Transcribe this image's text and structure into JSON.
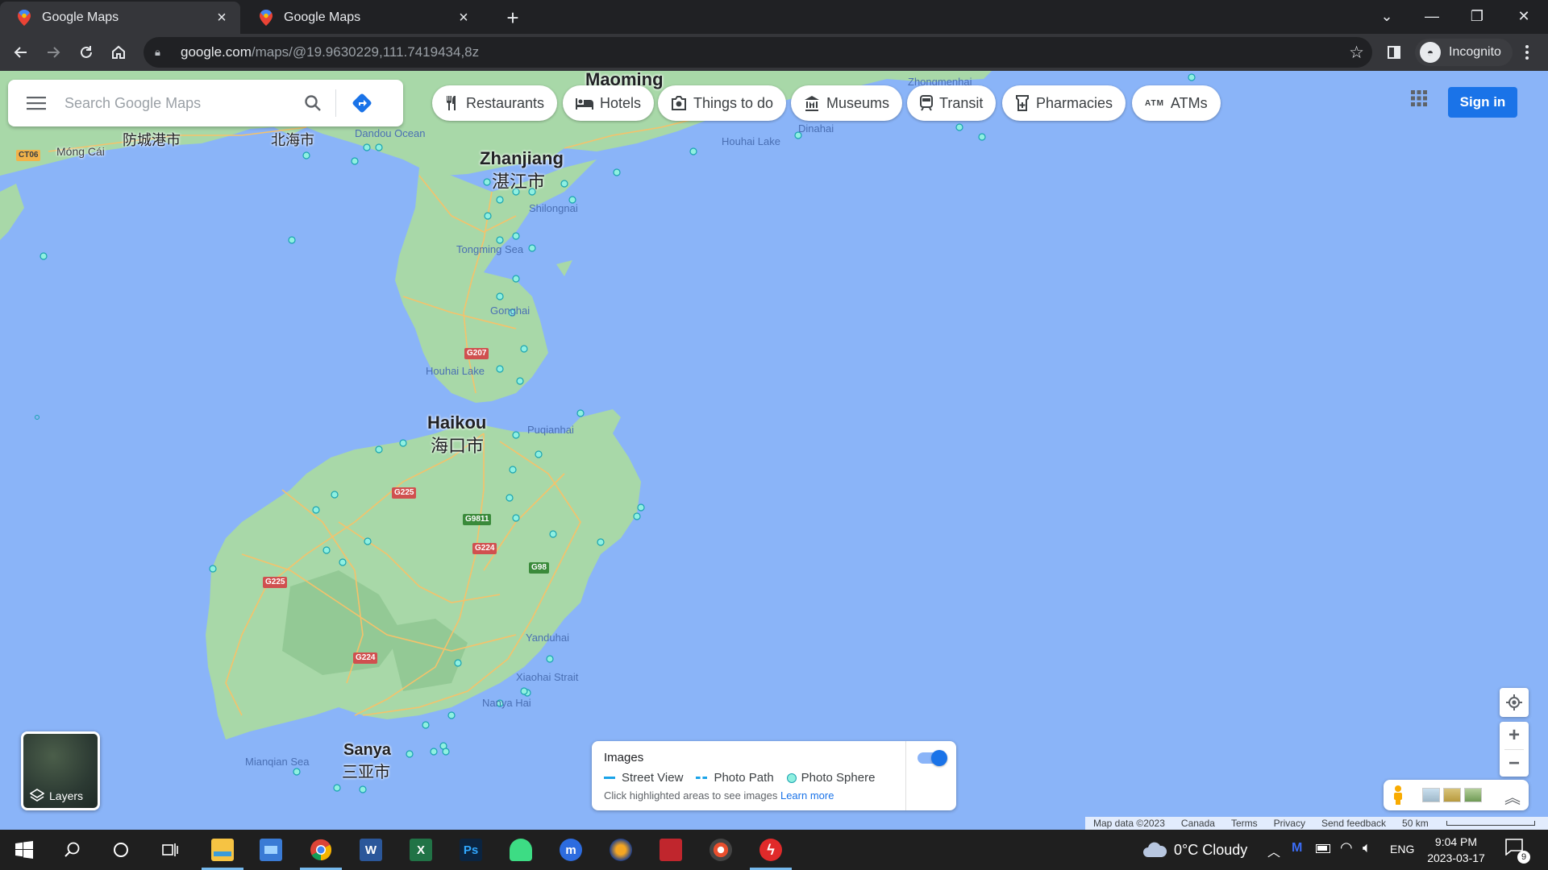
{
  "browser": {
    "tabs": [
      {
        "title": "Google Maps",
        "active": true
      },
      {
        "title": "Google Maps",
        "active": false
      }
    ],
    "url_host": "google.com",
    "url_path": "/maps/@19.9630229,111.7419434,8z",
    "profile_label": "Incognito"
  },
  "maps": {
    "search_placeholder": "Search Google Maps",
    "chips": [
      {
        "label": "Restaurants",
        "icon": "fork-knife-icon"
      },
      {
        "label": "Hotels",
        "icon": "bed-icon"
      },
      {
        "label": "Things to do",
        "icon": "camera-icon"
      },
      {
        "label": "Museums",
        "icon": "museum-icon"
      },
      {
        "label": "Transit",
        "icon": "train-icon"
      },
      {
        "label": "Pharmacies",
        "icon": "pharmacy-icon"
      },
      {
        "label": "ATMs",
        "icon": "atm-icon"
      }
    ],
    "atm_icon_text": "ATM",
    "sign_in": "Sign in",
    "layers_label": "Layers",
    "images_panel": {
      "heading": "Images",
      "legend": [
        "Street View",
        "Photo Path",
        "Photo Sphere"
      ],
      "hint": "Click highlighted areas to see images",
      "learn_more": "Learn more",
      "toggle_on": true
    },
    "attribution": {
      "map_data": "Map data ©2023",
      "region": "Canada",
      "terms": "Terms",
      "privacy": "Privacy",
      "feedback": "Send feedback",
      "scale": "50 km"
    },
    "labels": {
      "maoming": "Maoming",
      "zhongmenhai": "Zhongmenhai",
      "zhanjiang": "Zhanjiang",
      "zhanjiang_cn": "湛江市",
      "shilongnai": "Shilongnai",
      "tongming_sea": "Tongming Sea",
      "gonghai": "Gonghai",
      "houhai_lake_a": "Houhai Lake",
      "houhai_lake_b": "Houhai Lake",
      "dandou_ocean": "Dandou Ocean",
      "beihai_cn": "北海市",
      "fangchenggang_cn": "防城港市",
      "mong_cai": "Móng Cái",
      "ct06": "CT06",
      "haikou": "Haikou",
      "haikou_cn": "海口市",
      "puqianhai": "Puqianhai",
      "yanduhai": "Yanduhai",
      "xiaohai_strait": "Xiaohai Strait",
      "nanyahai": "Nanya Hai",
      "sanya": "Sanya",
      "sanya_cn": "三亚市",
      "mianqian_sea": "Mianqian Sea",
      "dinahai": "Dinahai"
    },
    "road_shields": {
      "g207": "G207",
      "g225_a": "G225",
      "g225_b": "G225",
      "g9811": "G9811",
      "g224_a": "G224",
      "g224_b": "G224",
      "g98": "G98"
    }
  },
  "taskbar": {
    "weather": "0°C Cloudy",
    "lang": "ENG",
    "time": "9:04 PM",
    "date": "2023-03-17",
    "notifications": "9",
    "apps": [
      {
        "name": "file-explorer-icon",
        "letter": ""
      },
      {
        "name": "control-panel-icon",
        "letter": ""
      },
      {
        "name": "chrome-icon",
        "letter": ""
      },
      {
        "name": "word-icon",
        "letter": "W"
      },
      {
        "name": "excel-icon",
        "letter": "X"
      },
      {
        "name": "photoshop-icon",
        "letter": "Ps"
      },
      {
        "name": "android-app-icon",
        "letter": ""
      },
      {
        "name": "mo-app-icon",
        "letter": "m"
      },
      {
        "name": "vpn-app-icon",
        "letter": ""
      },
      {
        "name": "media-app-icon",
        "letter": ""
      },
      {
        "name": "disc-app-icon",
        "letter": ""
      },
      {
        "name": "flash-app-icon",
        "letter": ""
      }
    ]
  },
  "colors": {
    "water": "#8ab4f8",
    "land": "#a8d8a8",
    "accent": "#1a73e8"
  }
}
